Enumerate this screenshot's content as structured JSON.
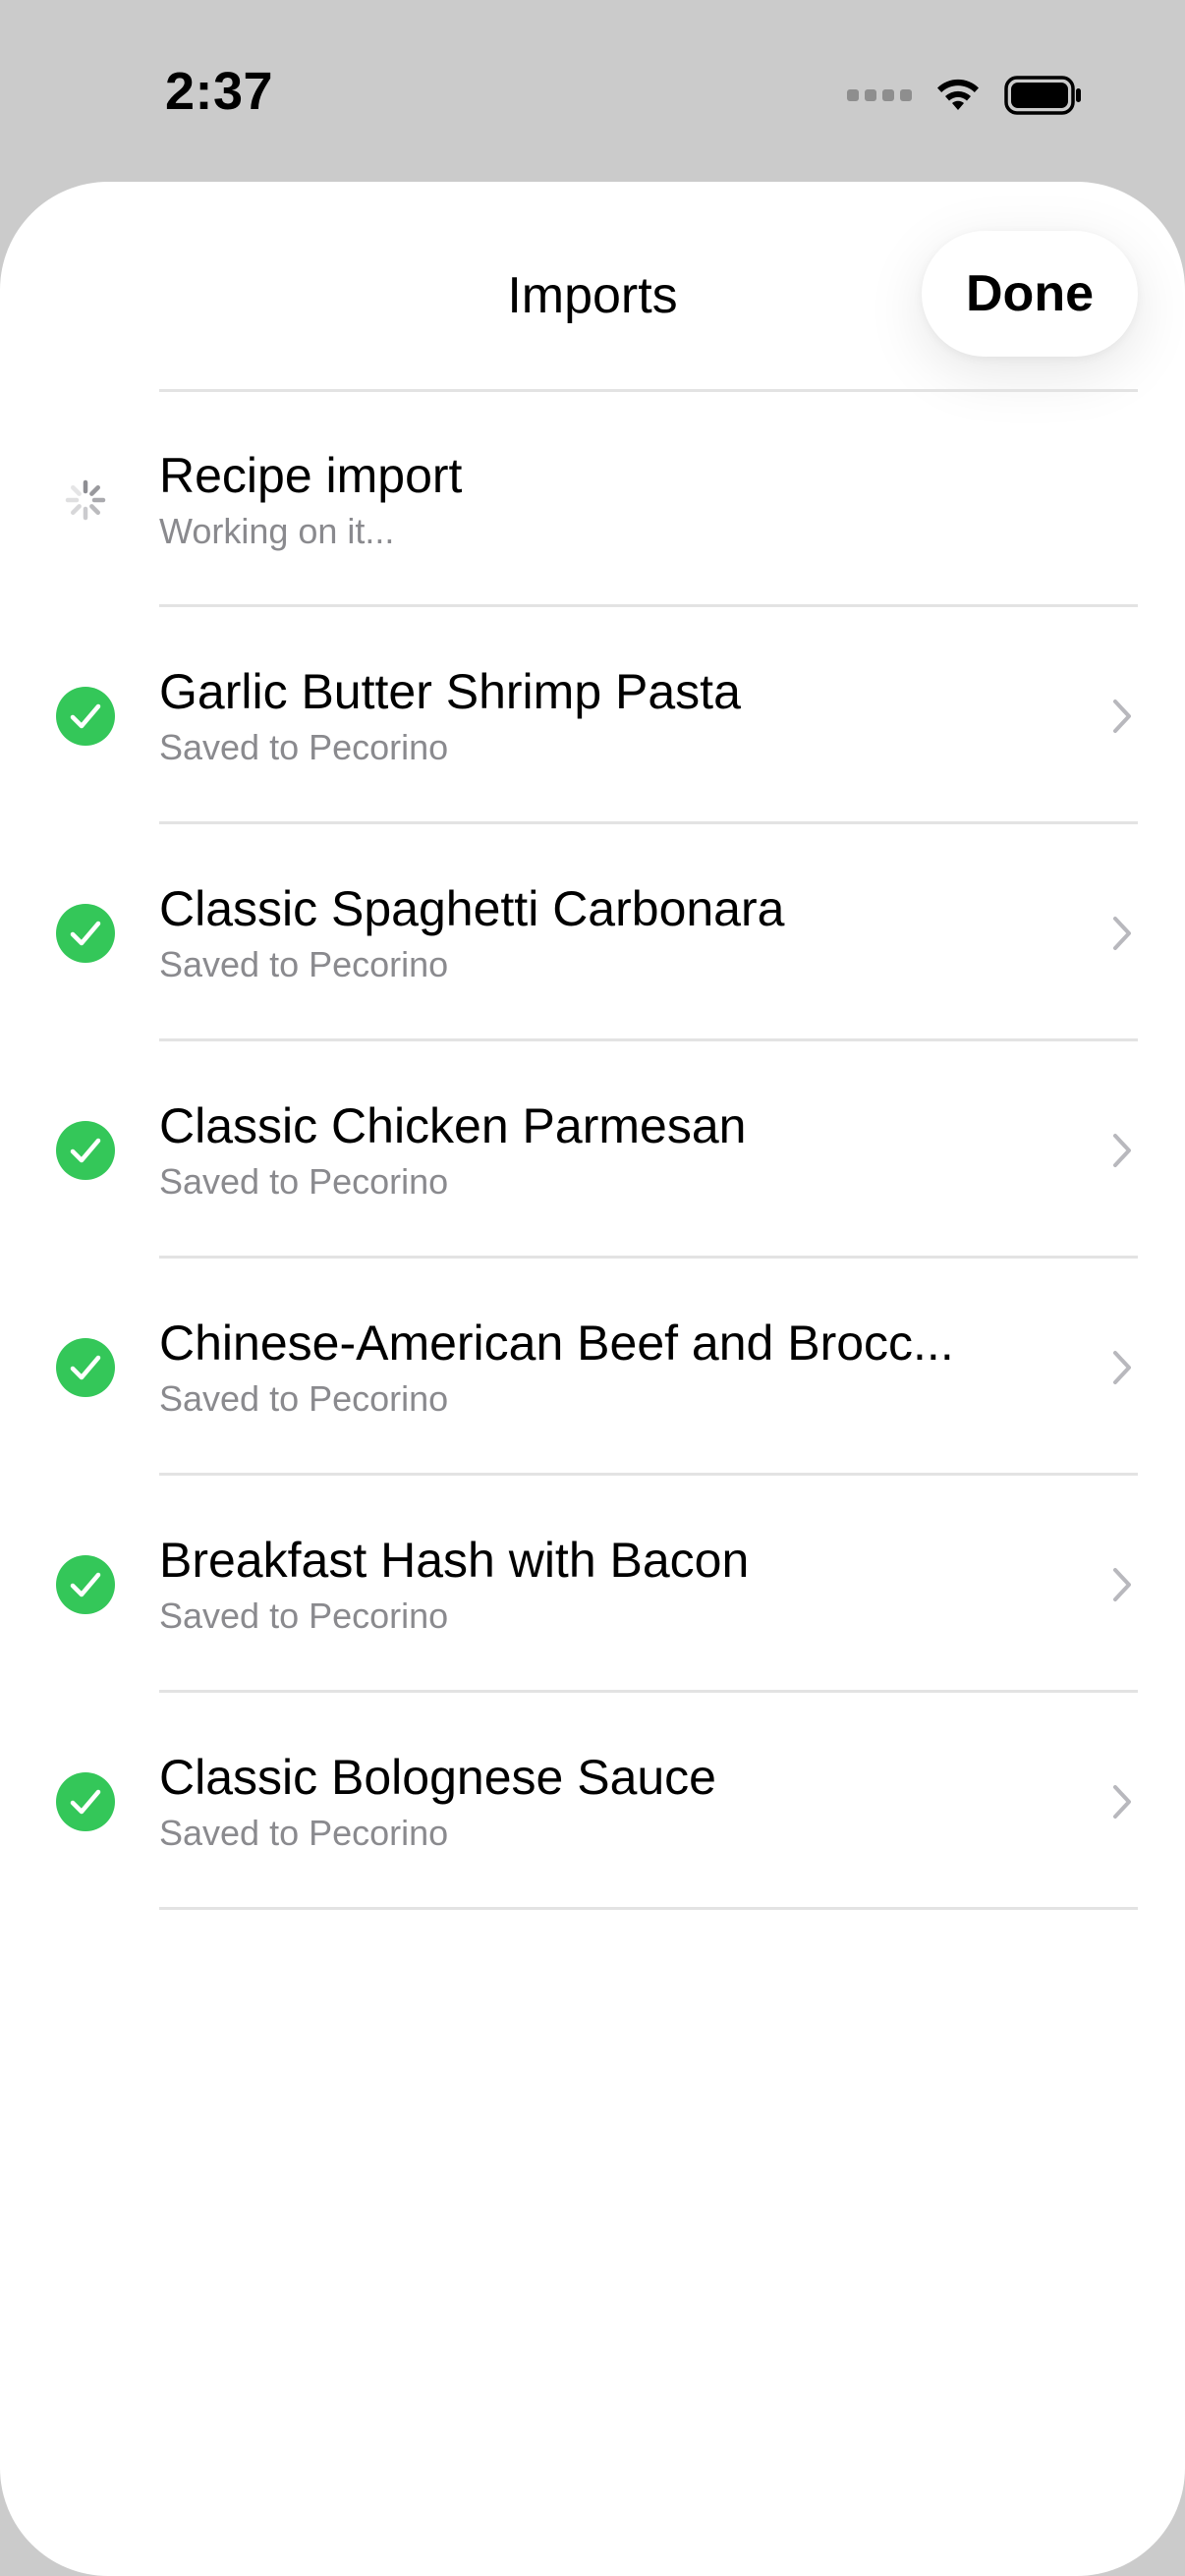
{
  "status_bar": {
    "time": "2:37"
  },
  "sheet": {
    "title": "Imports",
    "done_label": "Done"
  },
  "pending": {
    "title": "Recipe import",
    "subtitle": "Working on it..."
  },
  "items": [
    {
      "title": "Garlic Butter Shrimp Pasta",
      "subtitle": "Saved to Pecorino"
    },
    {
      "title": "Classic Spaghetti Carbonara",
      "subtitle": "Saved to Pecorino"
    },
    {
      "title": "Classic Chicken Parmesan",
      "subtitle": "Saved to Pecorino"
    },
    {
      "title": "Chinese-American Beef and Brocc...",
      "subtitle": "Saved to Pecorino"
    },
    {
      "title": "Breakfast Hash with Bacon",
      "subtitle": "Saved to Pecorino"
    },
    {
      "title": "Classic Bolognese Sauce",
      "subtitle": "Saved to Pecorino"
    }
  ],
  "icons": {
    "pending": "spinner-icon",
    "success": "checkmark-circle-icon",
    "disclosure": "chevron-right-icon"
  },
  "colors": {
    "success_green": "#34c759",
    "secondary_text": "#8a8a8e",
    "background": "#cbcbcb"
  }
}
